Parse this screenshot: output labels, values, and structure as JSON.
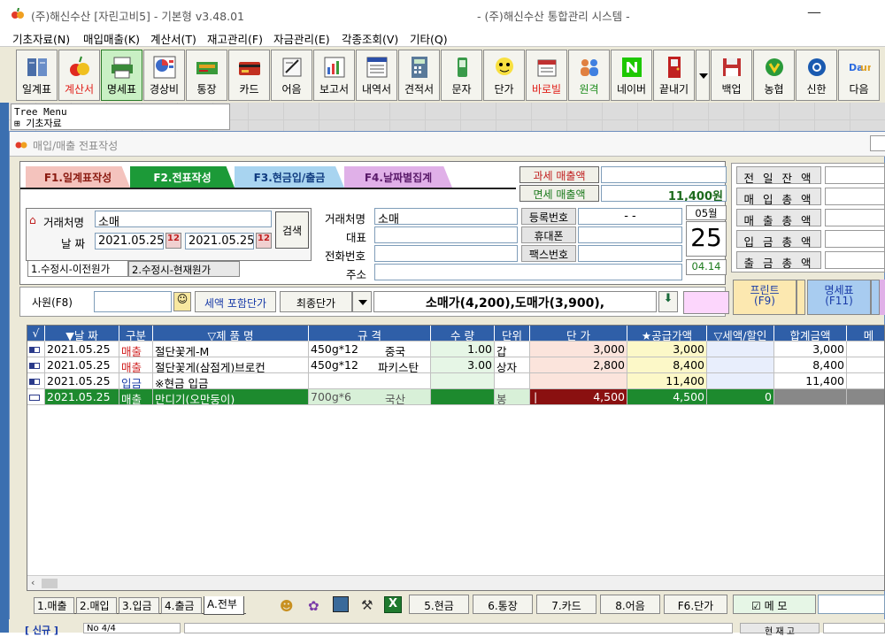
{
  "titlebar": {
    "title_left": "(주)해신수산   [자린고비5] - 기본형 v3.48.01",
    "title_right": "- (주)해신수산 통합관리 시스템 -",
    "minimize": "—"
  },
  "menu": [
    "기초자료(N)",
    "매입매출(K)",
    "계산서(T)",
    "재고관리(F)",
    "자금관리(E)",
    "각종조회(V)",
    "기타(Q)"
  ],
  "toolbar": [
    {
      "label": "일계표",
      "icon": "book-icon"
    },
    {
      "label": "계산서",
      "icon": "fruit-icon",
      "style": "red"
    },
    {
      "label": "명세표",
      "icon": "printer-icon",
      "style": "active"
    },
    {
      "label": "경상비",
      "icon": "pie-chart-icon"
    },
    {
      "label": "통장",
      "icon": "bankbook-icon"
    },
    {
      "label": "카드",
      "icon": "card-icon"
    },
    {
      "label": "어음",
      "icon": "note-icon"
    },
    {
      "label": "보고서",
      "icon": "report-icon"
    },
    {
      "label": "내역서",
      "icon": "list-icon"
    },
    {
      "label": "견적서",
      "icon": "calculator-icon"
    },
    {
      "label": "문자",
      "icon": "phone-icon"
    },
    {
      "label": "단가",
      "icon": "cartoon-icon"
    },
    {
      "label": "바로빌",
      "icon": "barobill-icon",
      "style": "red"
    },
    {
      "label": "원격",
      "icon": "people-icon",
      "style": "green"
    },
    {
      "label": "네이버",
      "icon": "naver-icon"
    },
    {
      "label": "끝내기",
      "icon": "exit-door-icon"
    },
    {
      "label": "백업",
      "icon": "disk-icon"
    },
    {
      "label": "농협",
      "icon": "nonghyup-icon"
    },
    {
      "label": "신한",
      "icon": "shinhan-icon"
    },
    {
      "label": "다음",
      "icon": "daum-icon"
    }
  ],
  "tree": {
    "line1": "Tree Menu",
    "line2": "⊞ 기초자료"
  },
  "window": {
    "title": "매입/매출 전표작성"
  },
  "ftabs": [
    "F1.일계표작성",
    "F2.전표작성",
    "F3.현금입/출금",
    "F4.날짜별집계"
  ],
  "search": {
    "client_label": "거래처명",
    "client_value": "소매",
    "date_label": "날  짜",
    "date_from": "2021.05.25",
    "date_to": "2021.05.25",
    "cal_btn": "12",
    "search_btn": "검색"
  },
  "subtabs": [
    "1.수정시-이전원가",
    "2.수정시-현재원가"
  ],
  "client_info": {
    "name_label": "거래처명",
    "name_value": "소매",
    "rep_label": "대표",
    "phone_label": "전화번호",
    "addr_label": "주소",
    "reg_label": "등록번호",
    "reg_value": "-   -",
    "mobile_label": "휴대폰",
    "fax_label": "팩스번호"
  },
  "calendar": {
    "month": "05월",
    "day": "25",
    "sub": "04.14"
  },
  "sales": {
    "tax_label": "과세 매출액",
    "tax_value": "",
    "exempt_label": "면세 매출액",
    "exempt_value": "11,400원"
  },
  "summary": [
    "전 일 잔 액",
    "매 입 총 액",
    "매 출 총 액",
    "입 금 총 액",
    "출 금 총 액"
  ],
  "bar2": {
    "staff": "사원(F8)",
    "vat_btn": "세액 포함단가",
    "last_price": "최종단가",
    "price_info": "소매가(4,200),도매가(3,900),",
    "print_btn": "프린트",
    "print_key": "(F9)",
    "stmt_btn": "명세표",
    "stmt_key": "(F11)"
  },
  "grid": {
    "headers": [
      "√",
      "▼날 짜",
      "구분",
      "▽제 품 명",
      "규    격",
      "수 량",
      "단위",
      "단    가",
      "★공급가액",
      "▽세액/할인",
      "합계금액",
      "메"
    ],
    "rows": [
      {
        "date": "2021.05.25",
        "type": "매출",
        "name": "절단꽃게-M",
        "spec1": "450g*12",
        "spec2": "중국",
        "qty": "1.00",
        "unit": "갑",
        "price": "3,000",
        "supply": "3,000",
        "tax": "",
        "total": "3,000"
      },
      {
        "date": "2021.05.25",
        "type": "매출",
        "name": "절단꽃게(삼점게)브로컨",
        "spec1": "450g*12",
        "spec2": "파키스탄",
        "qty": "3.00",
        "unit": "상자",
        "price": "2,800",
        "supply": "8,400",
        "tax": "",
        "total": "8,400"
      },
      {
        "date": "2021.05.25",
        "type": "입금",
        "name": "※현금 입금",
        "spec1": "",
        "spec2": "",
        "qty": "",
        "unit": "",
        "price": "",
        "supply": "11,400",
        "tax": "",
        "total": "11,400"
      },
      {
        "date": "2021.05.25",
        "type": "매출",
        "name": "만디기(오만둥이)",
        "spec1": "700g*6",
        "spec2": "국산",
        "qty": "",
        "unit": "봉",
        "price": "4,500",
        "supply": "4,500",
        "tax": "0",
        "total": ""
      }
    ]
  },
  "bottom": {
    "tabs": [
      "1.매출",
      "2.매입",
      "3.입금",
      "4.출금",
      "A.전부"
    ],
    "btns": [
      "5.현금",
      "6.통장",
      "7.카드",
      "8.어음",
      "F6.단가"
    ],
    "memo": "☑ 메  모"
  },
  "status": {
    "left": "[ 신규 ]",
    "mid": "No 4/4",
    "right": "현 재 고"
  }
}
